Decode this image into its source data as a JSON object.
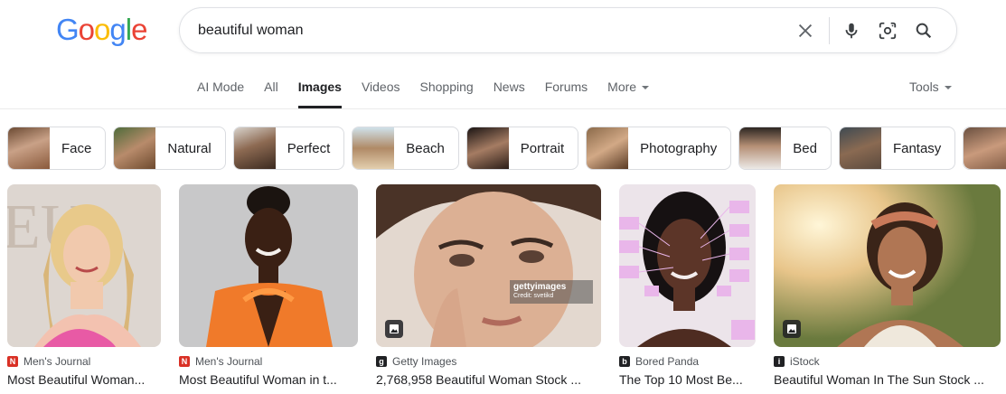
{
  "logo": {
    "letters": [
      "G",
      "o",
      "o",
      "g",
      "l",
      "e"
    ],
    "colors": [
      "#4285f4",
      "#ea4335",
      "#fbbc05",
      "#4285f4",
      "#34a853",
      "#ea4335"
    ]
  },
  "search": {
    "query": "beautiful woman",
    "icons": [
      "close-icon",
      "microphone-icon",
      "lens-camera-icon",
      "search-icon"
    ]
  },
  "tabs": [
    {
      "label": "AI Mode",
      "active": false
    },
    {
      "label": "All",
      "active": false
    },
    {
      "label": "Images",
      "active": true
    },
    {
      "label": "Videos",
      "active": false
    },
    {
      "label": "Shopping",
      "active": false
    },
    {
      "label": "News",
      "active": false
    },
    {
      "label": "Forums",
      "active": false
    },
    {
      "label": "More",
      "active": false
    }
  ],
  "tools_label": "Tools",
  "chips": [
    {
      "label": "Face"
    },
    {
      "label": "Natural"
    },
    {
      "label": "Perfect"
    },
    {
      "label": "Beach"
    },
    {
      "label": "Portrait"
    },
    {
      "label": "Photography"
    },
    {
      "label": "Bed"
    },
    {
      "label": "Fantasy"
    }
  ],
  "results": [
    {
      "source": "Men's Journal",
      "favicon_letter": "N",
      "favicon_color": "#d93025",
      "title": "Most Beautiful Woman..."
    },
    {
      "source": "Men's Journal",
      "favicon_letter": "N",
      "favicon_color": "#d93025",
      "title": "Most Beautiful Woman in t..."
    },
    {
      "source": "Getty Images",
      "favicon_letter": "g",
      "favicon_color": "#202124",
      "title": "2,768,958 Beautiful Woman Stock ...",
      "watermark": "gettyimages",
      "credit": "Credit: svetikd"
    },
    {
      "source": "Bored Panda",
      "favicon_letter": "b",
      "favicon_color": "#202124",
      "title": "The Top 10 Most Be..."
    },
    {
      "source": "iStock",
      "favicon_letter": "i",
      "favicon_color": "#202124",
      "title": "Beautiful Woman In The Sun Stock ..."
    }
  ]
}
